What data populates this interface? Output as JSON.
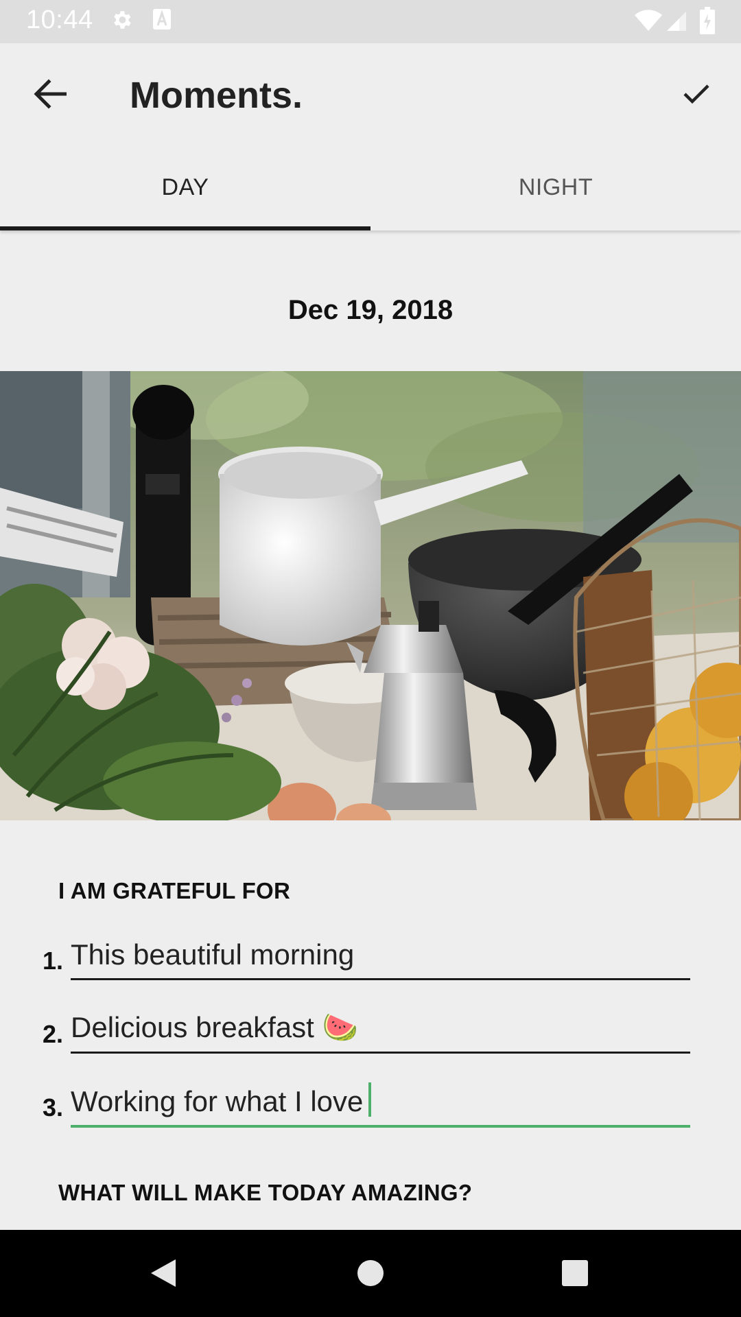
{
  "status_bar": {
    "time": "10:44",
    "icons": [
      "gear-icon",
      "a-icon",
      "wifi-icon",
      "signal-icon",
      "battery-icon"
    ]
  },
  "app_bar": {
    "title": "Moments.",
    "back_icon": "arrow-left-icon",
    "confirm_icon": "check-icon"
  },
  "tabs": [
    {
      "label": "DAY",
      "selected": true
    },
    {
      "label": "NIGHT",
      "selected": false
    }
  ],
  "entry": {
    "date": "Dec 19, 2018",
    "photo_alt": "kitchen-still-life-photo"
  },
  "grateful": {
    "heading": "I AM GRATEFUL FOR",
    "items": [
      {
        "number": "1.",
        "text": "This beautiful morning",
        "active": false
      },
      {
        "number": "2.",
        "text": "Delicious breakfast 🍉",
        "active": false
      },
      {
        "number": "3.",
        "text": "Working for what I love",
        "active": true
      }
    ]
  },
  "amazing": {
    "heading": "WHAT WILL MAKE TODAY AMAZING?"
  },
  "colors": {
    "background": "#eeeeee",
    "status_bar": "#dedede",
    "active_underline": "#4caf6a",
    "tab_indicator": "#1a1a1a",
    "nav_bar": "#000000"
  },
  "nav_bar": {
    "icons": [
      "nav-back-icon",
      "nav-home-icon",
      "nav-recents-icon"
    ]
  }
}
